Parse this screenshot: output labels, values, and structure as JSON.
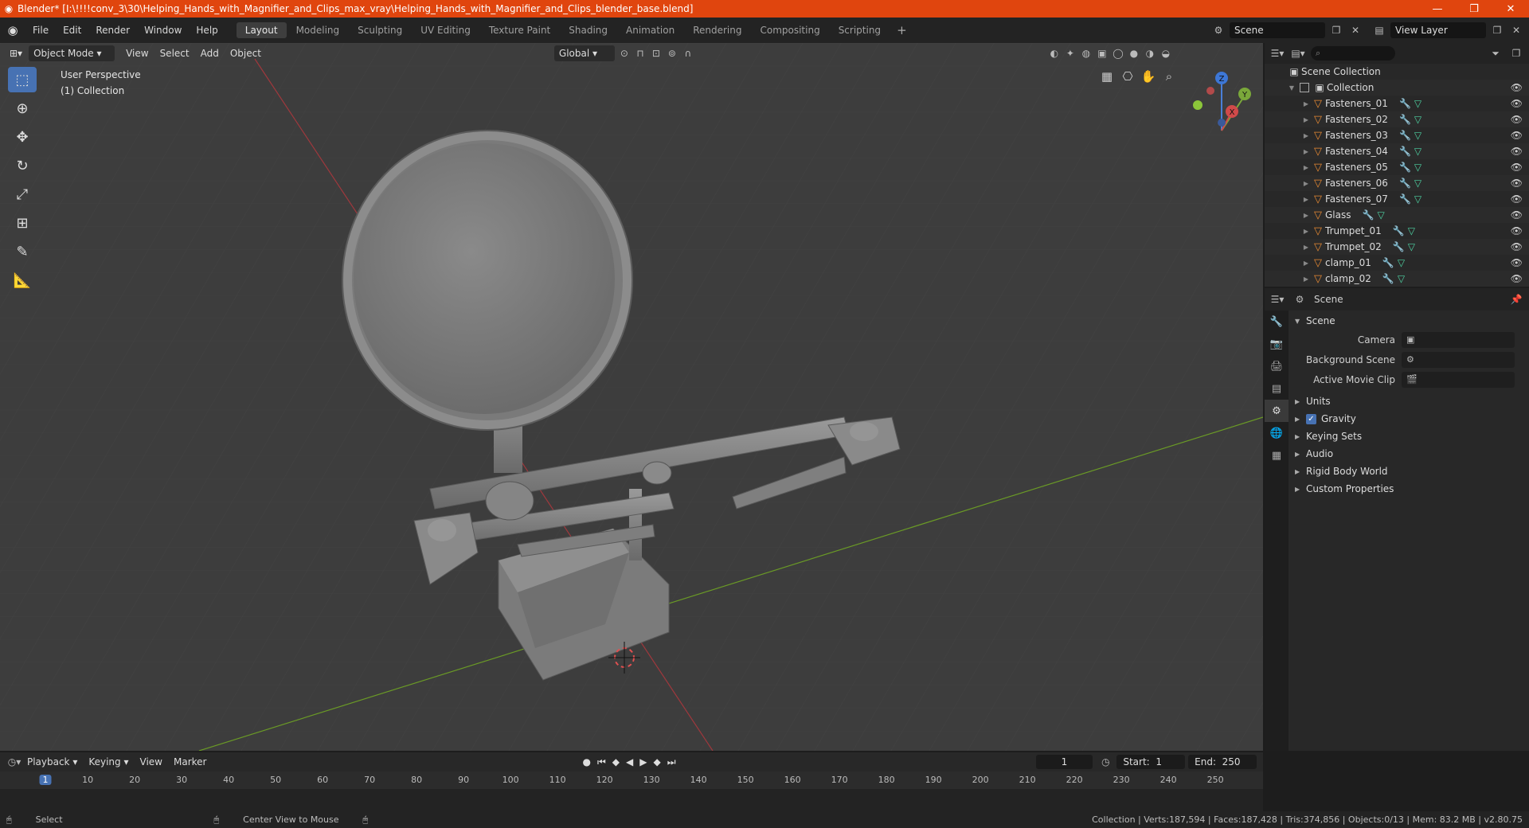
{
  "window": {
    "title": "Blender* [I:\\!!!!conv_3\\30\\Helping_Hands_with_Magnifier_and_Clips_max_vray\\Helping_Hands_with_Magnifier_and_Clips_blender_base.blend]",
    "minimize": "—",
    "maximize": "❐",
    "close": "✕"
  },
  "menu": [
    "File",
    "Edit",
    "Render",
    "Window",
    "Help"
  ],
  "workspaces": [
    "Layout",
    "Modeling",
    "Sculpting",
    "UV Editing",
    "Texture Paint",
    "Shading",
    "Animation",
    "Rendering",
    "Compositing",
    "Scripting"
  ],
  "active_workspace": "Layout",
  "scene_field": "Scene",
  "view_layer_field": "View Layer",
  "viewport": {
    "mode": "Object Mode",
    "menus": [
      "View",
      "Select",
      "Add",
      "Object"
    ],
    "orientation": "Global",
    "info_line1": "User Perspective",
    "info_line2": "(1) Collection"
  },
  "gizmo": {
    "x": "X",
    "y": "Y",
    "z": "Z"
  },
  "outliner": {
    "root": "Scene Collection",
    "collection": "Collection",
    "items": [
      "Fasteners_01",
      "Fasteners_02",
      "Fasteners_03",
      "Fasteners_04",
      "Fasteners_05",
      "Fasteners_06",
      "Fasteners_07",
      "Glass",
      "Trumpet_01",
      "Trumpet_02",
      "clamp_01",
      "clamp_02"
    ]
  },
  "properties": {
    "header": "Scene",
    "panel": "Scene",
    "camera_label": "Camera",
    "background_scene_label": "Background Scene",
    "active_movie_clip_label": "Active Movie Clip",
    "sections": [
      "Units",
      "Gravity",
      "Keying Sets",
      "Audio",
      "Rigid Body World",
      "Custom Properties"
    ]
  },
  "timeline": {
    "menus": [
      "Playback",
      "Keying",
      "View",
      "Marker"
    ],
    "current_frame": "1",
    "start_label": "Start:",
    "start": "1",
    "end_label": "End:",
    "end": "250",
    "ticks": [
      "1",
      "10",
      "20",
      "30",
      "40",
      "50",
      "60",
      "70",
      "80",
      "90",
      "100",
      "110",
      "120",
      "130",
      "140",
      "150",
      "160",
      "170",
      "180",
      "190",
      "200",
      "210",
      "220",
      "230",
      "240",
      "250"
    ]
  },
  "status": {
    "left": "Select",
    "middle": "Center View to Mouse",
    "stats": "Collection | Verts:187,594 | Faces:187,428 | Tris:374,856 | Objects:0/13 | Mem: 83.2 MB | v2.80.75"
  },
  "colors": {
    "accent": "#4772b3",
    "titlebar": "#e0450e",
    "mesh_icon": "#e88a33"
  }
}
